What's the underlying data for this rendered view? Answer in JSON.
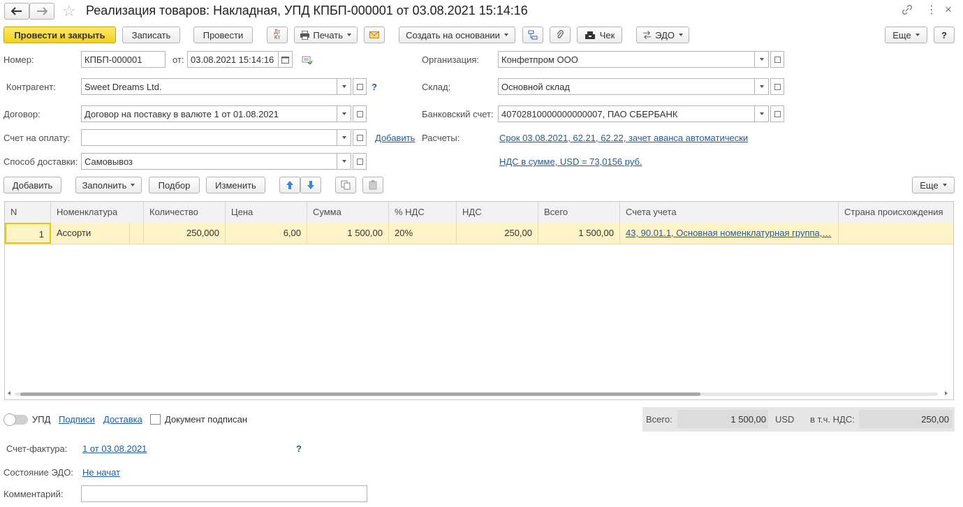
{
  "window": {
    "title": "Реализация товаров: Накладная, УПД КПБП-000001 от 03.08.2021 15:14:16"
  },
  "toolbar": {
    "post_close": "Провести и закрыть",
    "save": "Записать",
    "post": "Провести",
    "dt_kt": "Дт Кт",
    "print": "Печать",
    "create_based": "Создать на основании",
    "check": "Чек",
    "edo": "ЭДО",
    "more": "Еще",
    "help": "?"
  },
  "form": {
    "number_label": "Номер:",
    "number_value": "КПБП-000001",
    "date_label": "от:",
    "date_value": "03.08.2021 15:14:16",
    "org_label": "Организация:",
    "org_value": "Конфетпром ООО",
    "contractor_label": "Контрагент:",
    "contractor_value": "Sweet Dreams Ltd.",
    "help_q": "?",
    "warehouse_label": "Склад:",
    "warehouse_value": "Основной склад",
    "contract_label": "Договор:",
    "contract_value": "Договор на поставку в валюте 1 от 01.08.2021",
    "bank_label": "Банковский счет:",
    "bank_value": "40702810000000000007, ПАО СБЕРБАНК",
    "invoice_label": "Счет на оплату:",
    "invoice_value": "",
    "add_link": "Добавить",
    "settlements_label": "Расчеты:",
    "settlements_link": "Срок 03.08.2021, 62.21, 62.22, зачет аванса автоматически",
    "delivery_label": "Способ доставки:",
    "delivery_value": "Самовывоз",
    "vat_link": "НДС в сумме, USD = 73,0156 руб."
  },
  "table_toolbar": {
    "add": "Добавить",
    "fill": "Заполнить",
    "select": "Подбор",
    "change": "Изменить",
    "more": "Еще"
  },
  "table": {
    "columns": [
      "N",
      "Номенклатура",
      "Количество",
      "Цена",
      "Сумма",
      "% НДС",
      "НДС",
      "Всего",
      "Счета учета",
      "Страна происхождения"
    ],
    "rows": [
      {
        "n": "1",
        "item": "Ассорти",
        "qty": "250,000",
        "price": "6,00",
        "sum": "1 500,00",
        "vat_rate": "20%",
        "vat": "250,00",
        "total": "1 500,00",
        "accounts": "43, 90.01.1, Основная номенклатурная группа,…",
        "country": ""
      }
    ]
  },
  "footer": {
    "upd_label": "УПД",
    "signatures_link": "Подписи",
    "delivery_link": "Доставка",
    "signed_label": "Документ подписан",
    "total_label": "Всего:",
    "total_value": "1 500,00",
    "currency": "USD",
    "vat_incl_label": "в т.ч. НДС:",
    "vat_incl_value": "250,00",
    "sf_label": "Счет-фактура:",
    "sf_link": "1 от 03.08.2021",
    "sf_help": "?",
    "edo_state_label": "Состояние ЭДО:",
    "edo_state_link": "Не начат",
    "comment_label": "Комментарий:",
    "comment_value": ""
  }
}
